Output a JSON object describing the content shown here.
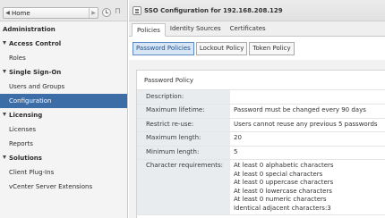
{
  "navigator": {
    "home_label": "Home",
    "items": [
      {
        "label": "Administration",
        "type": "header",
        "expanded": false
      },
      {
        "label": "Access Control",
        "type": "group",
        "expanded": true
      },
      {
        "label": "Roles",
        "type": "child"
      },
      {
        "label": "Single Sign-On",
        "type": "group",
        "expanded": true
      },
      {
        "label": "Users and Groups",
        "type": "child"
      },
      {
        "label": "Configuration",
        "type": "child",
        "selected": true
      },
      {
        "label": "Licensing",
        "type": "group",
        "expanded": true
      },
      {
        "label": "Licenses",
        "type": "child"
      },
      {
        "label": "Reports",
        "type": "child"
      },
      {
        "label": "Solutions",
        "type": "group",
        "expanded": true
      },
      {
        "label": "Client Plug-Ins",
        "type": "child"
      },
      {
        "label": "vCenter Server Extensions",
        "type": "child"
      }
    ]
  },
  "content": {
    "title": "SSO Configuration for 192.168.208.129",
    "tabs": [
      {
        "label": "Policies",
        "active": true
      },
      {
        "label": "Identity Sources",
        "active": false
      },
      {
        "label": "Certificates",
        "active": false
      }
    ],
    "subtabs": [
      {
        "label": "Password Policies",
        "active": true
      },
      {
        "label": "Lockout Policy",
        "active": false
      },
      {
        "label": "Token Policy",
        "active": false
      }
    ],
    "panel_title": "Password Policy",
    "policy": {
      "description": {
        "label": "Description:",
        "value": ""
      },
      "max_lifetime": {
        "label": "Maximum lifetime:",
        "value": "Password must be changed every 90 days"
      },
      "restrict_reuse": {
        "label": "Restrict re-use:",
        "value": "Users cannot reuse any previous 5 passwords"
      },
      "max_length": {
        "label": "Maximum length:",
        "value": "20"
      },
      "min_length": {
        "label": "Minimum length:",
        "value": "5"
      },
      "char_requirements": {
        "label": "Character requirements:",
        "values": [
          "At least 0 alphabetic characters",
          "At least 0 special characters",
          "At least 0 uppercase characters",
          "At least 0 lowercase characters",
          "At least 0 numeric characters",
          "Identical adjacent characters:3"
        ]
      }
    }
  },
  "colors": {
    "selected_nav_bg": "#3d6da6",
    "active_subtab_bg": "#d8e5f4",
    "label_cell_bg": "#e9ecef"
  }
}
